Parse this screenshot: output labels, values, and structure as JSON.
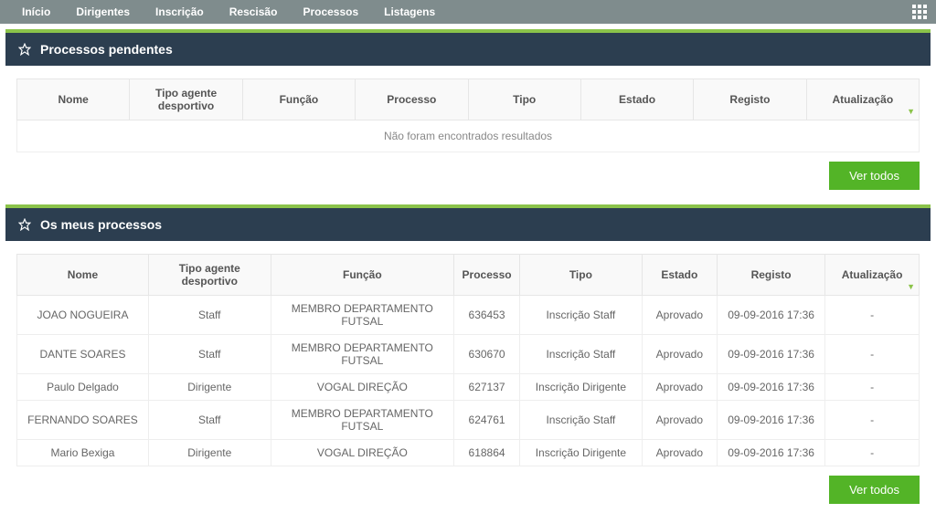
{
  "nav": {
    "items": [
      "Início",
      "Dirigentes",
      "Inscrição",
      "Rescisão",
      "Processos",
      "Listagens"
    ]
  },
  "pending": {
    "title": "Processos pendentes",
    "columns": [
      "Nome",
      "Tipo agente desportivo",
      "Função",
      "Processo",
      "Tipo",
      "Estado",
      "Registo",
      "Atualização"
    ],
    "empty_message": "Não foram encontrados resultados",
    "view_all": "Ver todos"
  },
  "mine": {
    "title": "Os meus processos",
    "columns": [
      "Nome",
      "Tipo agente desportivo",
      "Função",
      "Processo",
      "Tipo",
      "Estado",
      "Registo",
      "Atualização"
    ],
    "rows": [
      {
        "nome": "JOAO NOGUEIRA",
        "tipo_agente": "Staff",
        "funcao": "MEMBRO DEPARTAMENTO FUTSAL",
        "processo": "636453",
        "tipo": "Inscrição Staff",
        "estado": "Aprovado",
        "registo": "09-09-2016 17:36",
        "atualizacao": "-"
      },
      {
        "nome": "DANTE SOARES",
        "tipo_agente": "Staff",
        "funcao": "MEMBRO DEPARTAMENTO FUTSAL",
        "processo": "630670",
        "tipo": "Inscrição Staff",
        "estado": "Aprovado",
        "registo": "09-09-2016 17:36",
        "atualizacao": "-"
      },
      {
        "nome": "Paulo Delgado",
        "tipo_agente": "Dirigente",
        "funcao": "VOGAL DIREÇÃO",
        "processo": "627137",
        "tipo": "Inscrição Dirigente",
        "estado": "Aprovado",
        "registo": "09-09-2016 17:36",
        "atualizacao": "-"
      },
      {
        "nome": "FERNANDO SOARES",
        "tipo_agente": "Staff",
        "funcao": "MEMBRO DEPARTAMENTO FUTSAL",
        "processo": "624761",
        "tipo": "Inscrição Staff",
        "estado": "Aprovado",
        "registo": "09-09-2016 17:36",
        "atualizacao": "-"
      },
      {
        "nome": "Mario Bexiga",
        "tipo_agente": "Dirigente",
        "funcao": "VOGAL DIREÇÃO",
        "processo": "618864",
        "tipo": "Inscrição Dirigente",
        "estado": "Aprovado",
        "registo": "09-09-2016 17:36",
        "atualizacao": "-"
      }
    ],
    "view_all": "Ver todos"
  }
}
